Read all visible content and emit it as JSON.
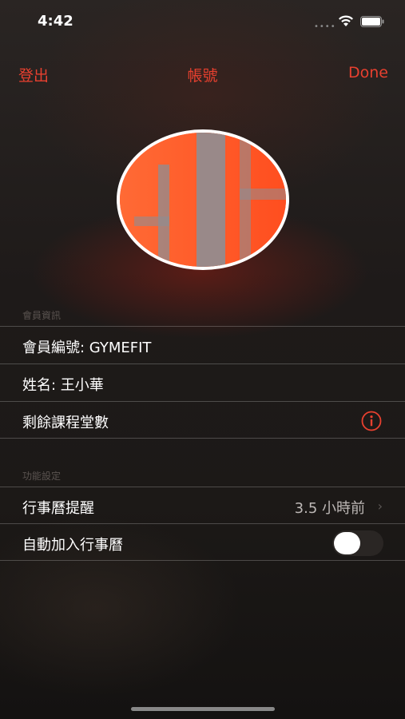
{
  "status_bar": {
    "time": "4:42",
    "signal": "••••"
  },
  "nav": {
    "left_label": "登出",
    "title": "帳號",
    "right_label": "Done"
  },
  "avatar": {
    "icon": "avatar-image"
  },
  "member_section": {
    "header": "會員資訊",
    "rows": [
      {
        "label": "會員編號: GYMEFIT"
      },
      {
        "label": "姓名: 王小華"
      },
      {
        "label": "剩餘課程堂數",
        "icon": "info-icon"
      }
    ]
  },
  "settings_section": {
    "header": "功能設定",
    "reminder": {
      "label": "行事曆提醒",
      "value": "3.5 小時前"
    },
    "auto_add": {
      "label": "自動加入行事曆",
      "enabled": false
    }
  },
  "colors": {
    "accent": "#e8402f",
    "avatar_orange": "#ff5a2a",
    "avatar_gray": "#8e8e93"
  }
}
